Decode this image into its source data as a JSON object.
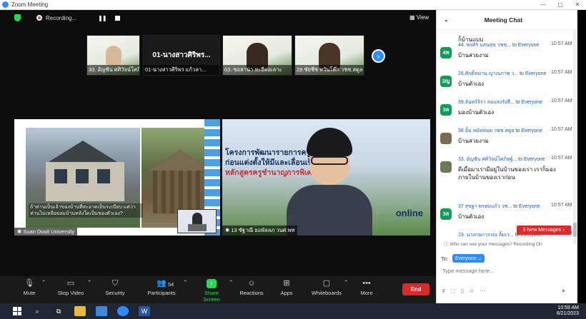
{
  "window": {
    "title": "Zoom Meeting",
    "controls": [
      "—",
      "▢",
      "✕"
    ]
  },
  "topbar": {
    "recording": "Recording...",
    "view": "View"
  },
  "thumbnails": [
    {
      "label": "33. อัญชัน ศศิวัจน์โศภิษฐ์..."
    },
    {
      "label": "01-นางสาวศิริพร  แก้วลา...",
      "bigname": "01-นางสาวศิริพร..."
    },
    {
      "label": "03. ซอฮาน่า หะยีดอเลาะ"
    },
    {
      "label": "29.ชัยชีช หวันโต๊ก วชช.สตูล"
    }
  ],
  "tiles": {
    "left": {
      "label": "Suan Dusit University",
      "caption": "ถ้าท่านเป็นเจ้าของบ้านที่สะอาดเป็นระเบียบ แต่ว่าท่านไม่เหลือยอมบ้านหลังใดเป็นของตัวเอง?"
    },
    "right": {
      "label": "13 ซัฐาณี ยอพัลลภ วนศ.พท",
      "banner1": "โครงการพัฒนารายการครู...การศึกษา",
      "banner2": "ก่อนแต่งตั้งให้มีและเลื่อนเป็น...",
      "banner3": "หลักสูตรครูชำนาญการพิเศษ",
      "online": "online"
    }
  },
  "toolbar": {
    "mute": "Mute",
    "stop_video": "Stop Video",
    "security": "Security",
    "participants": "Participants",
    "participants_count": "54",
    "share_screen": "Share Screen",
    "reactions": "Reactions",
    "apps": "Apps",
    "whiteboards": "Whiteboards",
    "more": "More",
    "end": "End"
  },
  "chat": {
    "title": "Meeting Chat",
    "partial_top": "ก็บ้านแบบ",
    "messages": [
      {
        "from": "44. พรศิริ แสนสุข วชช...",
        "to": "Everyone",
        "time": "10:57 AM",
        "text": "บ้านสวยงาม",
        "avatar": "4พ"
      },
      {
        "from": "26.ศักดิ์หมาน ญาณภาพ ว...",
        "to": "Everyone",
        "time": "10:57 AM",
        "text": "บ้านตัวเอง",
        "avatar": "2ญ"
      },
      {
        "from": "39.จันทร์จิรา สอแสงรังสี...",
        "to": "Everyone",
        "time": "10:57 AM",
        "text": "มองบ้านตัวเอง",
        "avatar": "3ล"
      },
      {
        "from": "38 อิ้ม หมัดหมด วชช.สตูล",
        "to": "Everyone",
        "time": "10:57 AM",
        "text": "บ้านสวยงาม",
        "avatar": ""
      },
      {
        "from": "33. อัญชัน ศศิวัจน์โศภิษฐ์...",
        "to": "Everyone",
        "time": "10:57 AM",
        "text": "ดีเมื่อมาเรามีอยู่ในบ้านของเรา เราก็มองภายในบ้านของเราก่อน",
        "avatar": ""
      },
      {
        "from": "37 สุขฐา  พรหมแก้ว วช...",
        "to": "Everyone",
        "time": "10:57 AM",
        "text": "บ้านตัวเอง",
        "avatar": "3ล"
      },
      {
        "from": "19.  นางกนกวรรณ  ลิ้มเร...",
        "to": "Everyone",
        "time": "10:57 AM",
        "text": "",
        "avatar": ""
      }
    ],
    "new_messages": "3 New Messages ↓",
    "who_can_see": "Who can see your messages? Recording On",
    "to_label": "To:",
    "to_value": "Everyone",
    "input_placeholder": "Type message here..."
  },
  "taskbar": {
    "time": "10:59 AM",
    "date": "6/21/2023"
  }
}
